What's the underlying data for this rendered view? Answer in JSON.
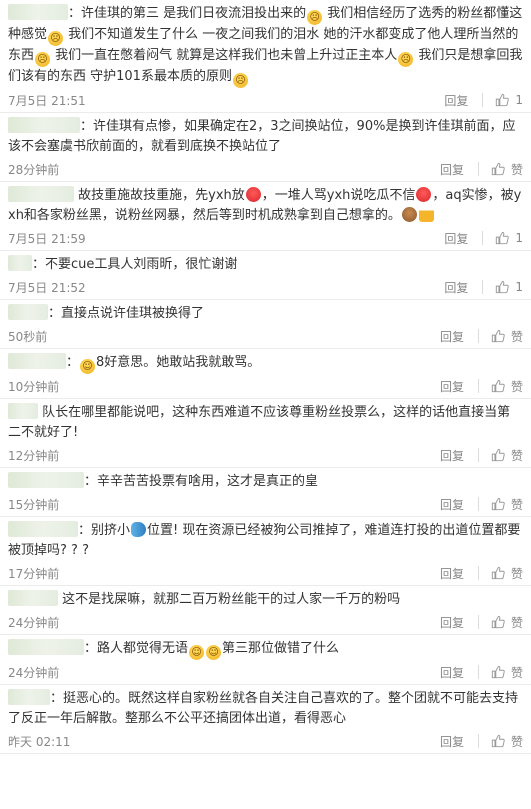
{
  "reply_label": "回复",
  "like_label": "赞",
  "comments": [
    {
      "user_w": 60,
      "prefix": "：",
      "segments": [
        {
          "t": "许佳琪的第三 是我们日夜流泪投出来的"
        },
        {
          "e": "sad"
        },
        {
          "t": " 我们相信经历了选秀的粉丝都懂这种感觉"
        },
        {
          "e": "sad"
        },
        {
          "t": " 我们不知道发生了什么 一夜之间我们的泪水 她的汗水都变成了他人理所当然的东西"
        },
        {
          "e": "sad"
        },
        {
          "t": " 我们一直在憋着闷气 就算是这样我们也未曾上升过正主本人"
        },
        {
          "e": "sad"
        },
        {
          "t": " 我们只是想拿回我们该有的东西 守护101系最本质的原则"
        },
        {
          "e": "sad"
        }
      ],
      "time": "7月5日 21:51",
      "likes": "1"
    },
    {
      "user_w": 72,
      "prefix": "：",
      "segments": [
        {
          "t": "许佳琪有点惨，如果确定在2，3之间换站位，90%是换到许佳琪前面，应该不会塞虞书欣前面的，就看到底换不换站位了"
        }
      ],
      "time": "28分钟前",
      "likes": ""
    },
    {
      "user_w": 66,
      "prefix": " ",
      "segments": [
        {
          "t": "故技重施故技重施，先yxh放"
        },
        {
          "e": "melon"
        },
        {
          "t": "，一堆人骂yxh说吃瓜不信"
        },
        {
          "e": "melon"
        },
        {
          "t": "，aq实惨，被yxh和各家粉丝黑，说粉丝网暴，然后等到时机成熟拿到自己想拿的。"
        },
        {
          "e": "dog"
        },
        {
          "e": "beer"
        }
      ],
      "time": "7月5日 21:59",
      "likes": "1"
    },
    {
      "user_w": 24,
      "prefix": "：",
      "segments": [
        {
          "t": "不要cue工具人刘雨昕，很忙谢谢"
        }
      ],
      "time": "7月5日 21:52",
      "likes": "1"
    },
    {
      "user_w": 40,
      "prefix": "：",
      "segments": [
        {
          "t": "直接点说许佳琪被换得了"
        }
      ],
      "time": "50秒前",
      "likes": ""
    },
    {
      "user_w": 58,
      "prefix": "：",
      "segments": [
        {
          "e": "smile"
        },
        {
          "t": "8好意思。她敢站我就敢骂。"
        }
      ],
      "time": "10分钟前",
      "likes": ""
    },
    {
      "user_w": 30,
      "prefix": " ",
      "segments": [
        {
          "t": "队长在哪里都能说吧，这种东西难道不应该尊重粉丝投票么，这样的话他直接当第二不就好了!"
        }
      ],
      "time": "12分钟前",
      "likes": ""
    },
    {
      "user_w": 76,
      "prefix": "：",
      "segments": [
        {
          "t": "辛辛苦苦投票有啥用，这才是真正的皇"
        }
      ],
      "time": "15分钟前",
      "likes": ""
    },
    {
      "user_w": 70,
      "prefix": "：",
      "segments": [
        {
          "t": "别挤小"
        },
        {
          "e": "fish"
        },
        {
          "t": "位置! 现在资源已经被狗公司推掉了，难道连打投的出道位置都要被顶掉吗? ? ?"
        }
      ],
      "time": "17分钟前",
      "likes": ""
    },
    {
      "user_w": 50,
      "prefix": " ",
      "segments": [
        {
          "t": "这不是找屎嘛，就那二百万粉丝能干的过人家一千万的粉吗"
        }
      ],
      "time": "24分钟前",
      "likes": ""
    },
    {
      "user_w": 76,
      "prefix": "：",
      "segments": [
        {
          "t": "路人都觉得无语"
        },
        {
          "e": "smile"
        },
        {
          "e": "smile"
        },
        {
          "t": "第三那位做错了什么"
        }
      ],
      "time": "24分钟前",
      "likes": ""
    },
    {
      "user_w": 42,
      "prefix": "：",
      "segments": [
        {
          "t": "挺恶心的。既然这样自家粉丝就各自关注自己喜欢的了。整个团就不可能去支持了反正一年后解散。整那么不公平还搞团体出道，看得恶心"
        }
      ],
      "time": "昨天 02:11",
      "likes": ""
    }
  ]
}
